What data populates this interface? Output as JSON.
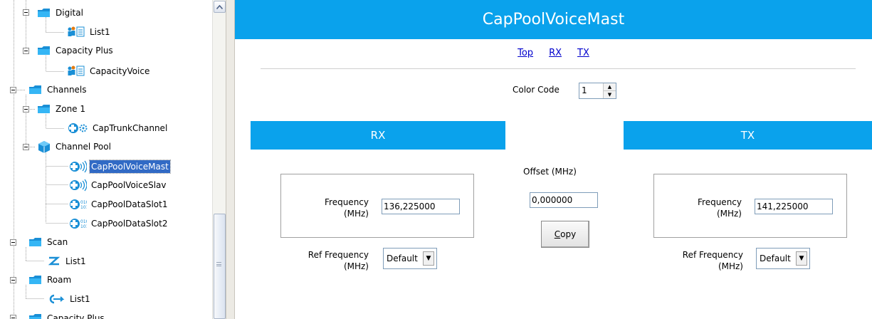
{
  "tree": {
    "nodes": [
      {
        "label": "Digital",
        "icon": "folder-icon"
      },
      {
        "label": "List1",
        "icon": "talkgroup-list-icon"
      },
      {
        "label": "Capacity Plus",
        "icon": "folder-icon"
      },
      {
        "label": "CapacityVoice",
        "icon": "talkgroup-list-icon"
      },
      {
        "label": "Channels",
        "icon": "folder-icon"
      },
      {
        "label": "Zone 1",
        "icon": "folder-icon"
      },
      {
        "label": "CapTrunkChannel",
        "icon": "trunk-channel-icon"
      },
      {
        "label": "Channel Pool",
        "icon": "cube-icon"
      },
      {
        "label": "CapPoolVoiceMast",
        "icon": "voice-channel-icon"
      },
      {
        "label": "CapPoolVoiceSlav",
        "icon": "voice-channel-icon"
      },
      {
        "label": "CapPoolDataSlot1",
        "icon": "data-channel-icon"
      },
      {
        "label": "CapPoolDataSlot2",
        "icon": "data-channel-icon"
      },
      {
        "label": "Scan",
        "icon": "folder-icon"
      },
      {
        "label": "List1",
        "icon": "scan-list-icon"
      },
      {
        "label": "Roam",
        "icon": "folder-icon"
      },
      {
        "label": "List1",
        "icon": "roam-list-icon"
      },
      {
        "label": "Capacity Plus",
        "icon": "folder-icon"
      }
    ],
    "selected_label": "CapPoolVoiceMast"
  },
  "main": {
    "title": "CapPoolVoiceMast",
    "nav_links": [
      "Top",
      "RX",
      "TX"
    ],
    "color_code": {
      "label": "Color Code",
      "value": "1"
    },
    "rx": {
      "header": "RX",
      "frequency_label_line1": "Frequency",
      "frequency_label_line2": "(MHz)",
      "frequency_value": "136,225000",
      "ref_label_line1": "Ref Frequency",
      "ref_label_line2": "(MHz)",
      "ref_value": "Default"
    },
    "tx": {
      "header": "TX",
      "frequency_label_line1": "Frequency",
      "frequency_label_line2": "(MHz)",
      "frequency_value": "141,225000",
      "ref_label_line1": "Ref Frequency",
      "ref_label_line2": "(MHz)",
      "ref_value": "Default"
    },
    "offset": {
      "label": "Offset (MHz)",
      "value": "0,000000"
    },
    "copy_label": "Copy"
  },
  "colors": {
    "accent": "#0aa2ec",
    "selection": "#316ac5",
    "link": "#0000cc"
  }
}
